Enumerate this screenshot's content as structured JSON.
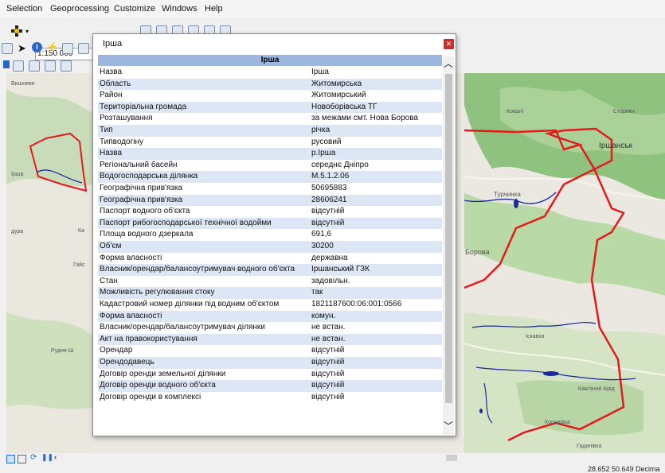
{
  "menu": {
    "items": [
      "Selection",
      "Geoprocessing",
      "Customize",
      "Windows",
      "Help"
    ]
  },
  "toolbar": {
    "scale": "1:150 000"
  },
  "dialog": {
    "title": "Ірша",
    "header": "Ірша",
    "rows": [
      {
        "k": "Назва",
        "v": "Ірша"
      },
      {
        "k": "Область",
        "v": "Житомирська"
      },
      {
        "k": "Район",
        "v": "Житомирський"
      },
      {
        "k": "Територіальна громада",
        "v": "Новоборівська ТГ"
      },
      {
        "k": "Розташування",
        "v": "за межами смт. Нова Борова"
      },
      {
        "k": "Тип",
        "v": "річка"
      },
      {
        "k": "Типводогіну",
        "v": "русовий"
      },
      {
        "k": "Назва",
        "v": "р.Ірша"
      },
      {
        "k": "Регіональний басейн",
        "v": "середнє Дніпро"
      },
      {
        "k": "Водогосподарська ділянка",
        "v": "М.5.1.2.06"
      },
      {
        "k": "Географічна прив'язка",
        "v": "50695883"
      },
      {
        "k": "Географічна прив'язка",
        "v": "28606241"
      },
      {
        "k": "Паспорт водного об'єкта",
        "v": "відсутній"
      },
      {
        "k": "Паспорт рибогосподарської технічної водойми",
        "v": "відсутній"
      },
      {
        "k": "Площа водного дзеркала",
        "v": "691,6"
      },
      {
        "k": "Об'єм",
        "v": "30200"
      },
      {
        "k": "Форма власності",
        "v": "державна"
      },
      {
        "k": "Власник/орендар/балансоутримувач водного об'єкта",
        "v": "Іршанський ГЗК"
      },
      {
        "k": "Стан",
        "v": "задовільн."
      },
      {
        "k": "Можливість регулювання стоку",
        "v": "так"
      },
      {
        "k": "Кадастровий номер ділянки під водним об'єктом",
        "v": "1821187600:06:001:0566"
      },
      {
        "k": "Форма власності",
        "v": "комун."
      },
      {
        "k": "Власник/орендар/балансоутримувач ділянки",
        "v": "не встан."
      },
      {
        "k": "Акт на правокористування",
        "v": "не встан."
      },
      {
        "k": "Орендар",
        "v": "відсутній"
      },
      {
        "k": "Орендодавець",
        "v": "відсутній"
      },
      {
        "k": "Договір оренди земельної ділянки",
        "v": "відсутній"
      },
      {
        "k": "Договір оренди водного об'єкта",
        "v": "відсутній"
      },
      {
        "k": "Договір оренди в комплексі",
        "v": "відсутній"
      }
    ]
  },
  "map": {
    "labels": [
      "Вишневе",
      "Ковалі",
      "Старики",
      "Іршанськ",
      "Турчинка",
      "Борова",
      "Кам'яний Брід",
      "Іскавка",
      "Копанівка",
      "Гадинівка",
      "Рудня-Ш",
      "Ірша",
      "Ка",
      "дура",
      "Гайс"
    ]
  },
  "status": {
    "coords": "28.652  50.649 Decima"
  },
  "colors": {
    "boundary": "#e41a1c",
    "water": "#1a2a9c",
    "forest": "#8fc27f",
    "header": "#9db6de",
    "alt_row": "#dce6f4"
  }
}
